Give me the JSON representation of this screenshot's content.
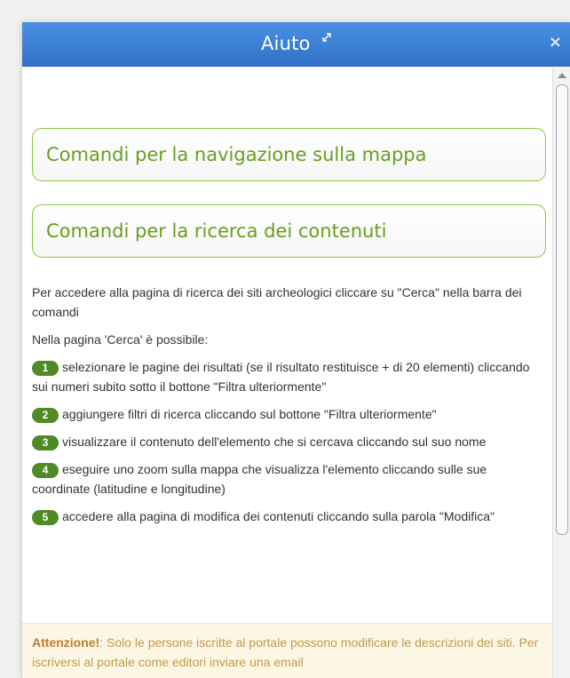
{
  "dialog": {
    "title": "Aiuto",
    "expand_icon": "expand-arrows-icon",
    "close_label": "×"
  },
  "sections": [
    {
      "label": "Comandi per la navigazione sulla mappa"
    },
    {
      "label": "Comandi per la ricerca dei contenuti"
    }
  ],
  "content": {
    "intro": "Per accedere alla pagina di ricerca dei siti archeologici cliccare su \"Cerca\" nella barra dei comandi",
    "lead": "Nella pagina 'Cerca' è possibile:",
    "items": [
      {
        "num": "1",
        "text": "selezionare le pagine dei risultati (se il risultato restituisce + di 20 elementi) cliccando sui numeri subito sotto il bottone \"Filtra ulteriormente\""
      },
      {
        "num": "2",
        "text": "aggiungere filtri di ricerca cliccando sul bottone \"Filtra ulteriormente\""
      },
      {
        "num": "3",
        "text": "visualizzare il contenuto dell'elemento che si cercava cliccando sul suo nome"
      },
      {
        "num": "4",
        "text": "eseguire uno zoom sulla mappa che visualizza l'elemento cliccando sulle sue coordinate (latitudine e longitudine)"
      },
      {
        "num": "5",
        "text": "accedere alla pagina di modifica dei contenuti cliccando sulla parola \"Modifica\""
      }
    ]
  },
  "warning": {
    "strong": "Attenzione!",
    "text": ": Solo le persone iscritte al portale possono modificare le descrizioni dei siti. Per iscriversi al portale come editori inviare una email"
  },
  "colors": {
    "titlebar": "#3d85d8",
    "accent_green": "#8cc63f",
    "badge_green": "#4f8a24",
    "warning_bg": "#fcf7e4"
  }
}
